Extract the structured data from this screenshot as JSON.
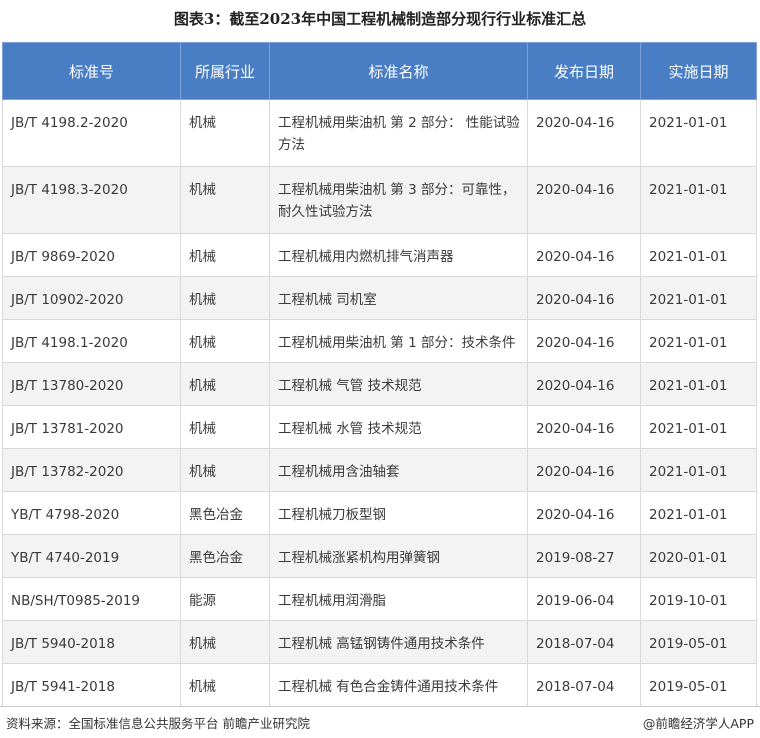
{
  "title": "图表3：截至2023年中国工程机械制造部分现行行业标准汇总",
  "headers": [
    "标准号",
    "所属行业",
    "标准名称",
    "发布日期",
    "实施日期"
  ],
  "rows": [
    [
      "JB/T 4198.2-2020",
      "机械",
      "工程机械用柴油机 第 2 部分： 性能试验方法",
      "2020-04-16",
      "2021-01-01"
    ],
    [
      "JB/T 4198.3-2020",
      "机械",
      "工程机械用柴油机 第 3 部分：可靠性，耐久性试验方法",
      "2020-04-16",
      "2021-01-01"
    ],
    [
      "JB/T 9869-2020",
      "机械",
      "工程机械用内燃机排气消声器",
      "2020-04-16",
      "2021-01-01"
    ],
    [
      "JB/T 10902-2020",
      "机械",
      "工程机械 司机室",
      "2020-04-16",
      "2021-01-01"
    ],
    [
      "JB/T 4198.1-2020",
      "机械",
      "工程机械用柴油机 第 1 部分：技术条件",
      "2020-04-16",
      "2021-01-01"
    ],
    [
      "JB/T 13780-2020",
      "机械",
      "工程机械 气管 技术规范",
      "2020-04-16",
      "2021-01-01"
    ],
    [
      "JB/T 13781-2020",
      "机械",
      "工程机械 水管 技术规范",
      "2020-04-16",
      "2021-01-01"
    ],
    [
      "JB/T 13782-2020",
      "机械",
      "工程机械用含油轴套",
      "2020-04-16",
      "2021-01-01"
    ],
    [
      "YB/T 4798-2020",
      "黑色冶金",
      "工程机械刀板型钢",
      "2020-04-16",
      "2021-01-01"
    ],
    [
      "YB/T 4740-2019",
      "黑色冶金",
      "工程机械涨紧机构用弹簧钢",
      "2019-08-27",
      "2020-01-01"
    ],
    [
      "NB/SH/T0985-2019",
      "能源",
      "工程机械用润滑脂",
      "2019-06-04",
      "2019-10-01"
    ],
    [
      "JB/T 5940-2018",
      "机械",
      "工程机械 高锰钢铸件通用技术条件",
      "2018-07-04",
      "2019-05-01"
    ],
    [
      "JB/T 5941-2018",
      "机械",
      "工程机械 有色合金铸件通用技术条件",
      "2018-07-04",
      "2019-05-01"
    ]
  ],
  "footer": {
    "source": "资料来源：全国标准信息公共服务平台 前瞻产业研究院",
    "brand": "@前瞻经济学人APP"
  },
  "colors": {
    "header_bg": "#4a7ec4",
    "row_alt": "#f3f3f3"
  }
}
